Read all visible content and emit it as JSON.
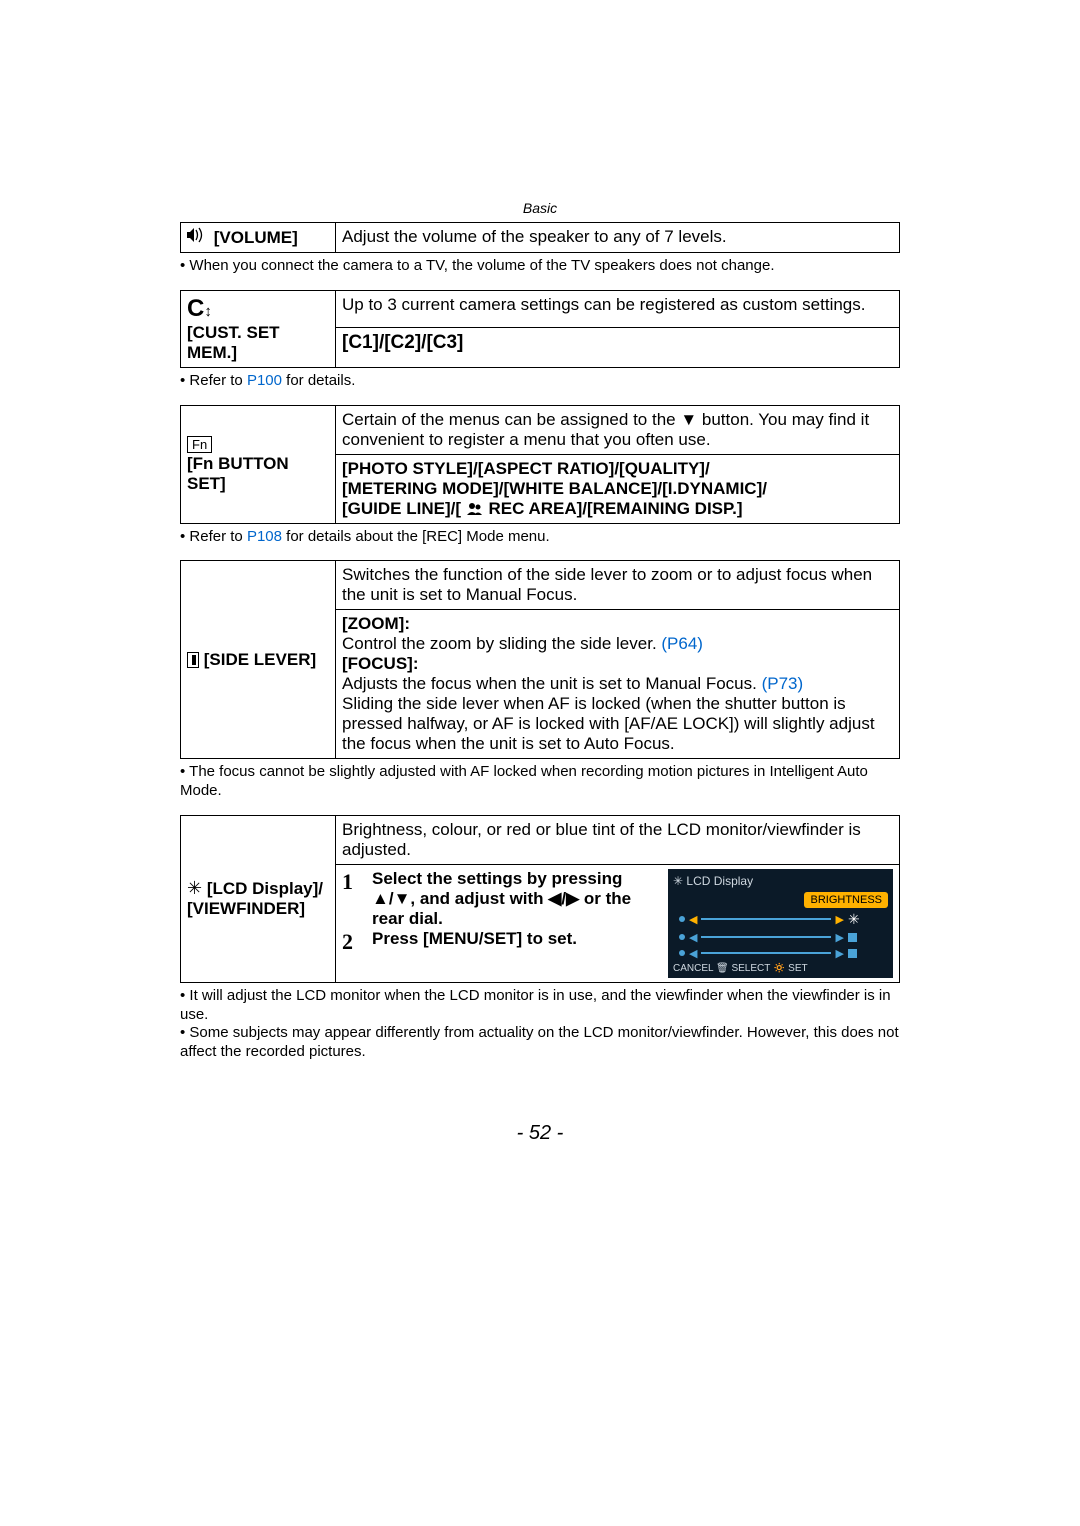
{
  "header": {
    "section": "Basic"
  },
  "volume": {
    "label": "[VOLUME]",
    "desc": "Adjust the volume of the speaker to any of 7 levels."
  },
  "volume_note": "When you connect the camera to a TV, the volume of the TV speakers does not change.",
  "cust": {
    "label": "[CUST. SET MEM.]",
    "desc": "Up to 3 current camera settings can be registered as custom settings.",
    "slots": "[C1]/[C2]/[C3]"
  },
  "cust_note_prefix": "Refer to ",
  "cust_note_link": "P100",
  "cust_note_suffix": " for details.",
  "fn": {
    "label": "[Fn BUTTON SET]",
    "desc_prefix": "Certain of the menus can be assigned to the ",
    "desc_suffix": " button. You may find it convenient to register a menu that you often use.",
    "options_line1": "[PHOTO STYLE]/[ASPECT RATIO]/[QUALITY]/",
    "options_line2": "[METERING MODE]/[WHITE BALANCE]/[I.DYNAMIC]/",
    "options_line3a": "[GUIDE LINE]/[",
    "options_line3b": " REC AREA]/[REMAINING DISP.]"
  },
  "fn_note_prefix": "Refer to ",
  "fn_note_link": "P108",
  "fn_note_suffix": " for details about the [REC] Mode menu.",
  "sidelever": {
    "label": "[SIDE LEVER]",
    "desc": "Switches the function of the side lever to zoom or to adjust focus when the unit is set to Manual Focus.",
    "zoom_label": "[ZOOM]:",
    "zoom_desc": "Control the zoom by sliding the side lever. ",
    "zoom_link": "(P64)",
    "focus_label": "[FOCUS]:",
    "focus_desc_prefix": "Adjusts the focus when the unit is set to Manual Focus. ",
    "focus_link": "(P73)",
    "focus_more": "Sliding the side lever when AF is locked (when the shutter button is pressed halfway, or AF is locked with [AF/AE LOCK]) will slightly adjust the focus when the unit is set to Auto Focus."
  },
  "sidelever_note": "The focus cannot be slightly adjusted with AF locked when recording motion pictures in Intelligent Auto Mode.",
  "lcd": {
    "label1": "[LCD Display]/",
    "label2": "[VIEWFINDER]",
    "desc": "Brightness, colour, or red or blue tint of the LCD monitor/viewfinder is adjusted.",
    "step1_a": "Select the settings by pressing",
    "step1_b": ", and adjust with ",
    "step1_c": " or the",
    "step1_d": "rear dial.",
    "step2": "Press [MENU/SET] to set."
  },
  "lcd_panel": {
    "title": "LCD Display",
    "highlight": "BRIGHTNESS",
    "bottom": "CANCEL 🗑 SELECT 🔅 SET"
  },
  "lcd_notes": [
    "It will adjust the LCD monitor when the LCD monitor is in use, and the viewfinder when the viewfinder is in use.",
    "Some subjects may appear differently from actuality on the LCD monitor/viewfinder. However, this does not affect the recorded pictures."
  ],
  "page": "- 52 -"
}
